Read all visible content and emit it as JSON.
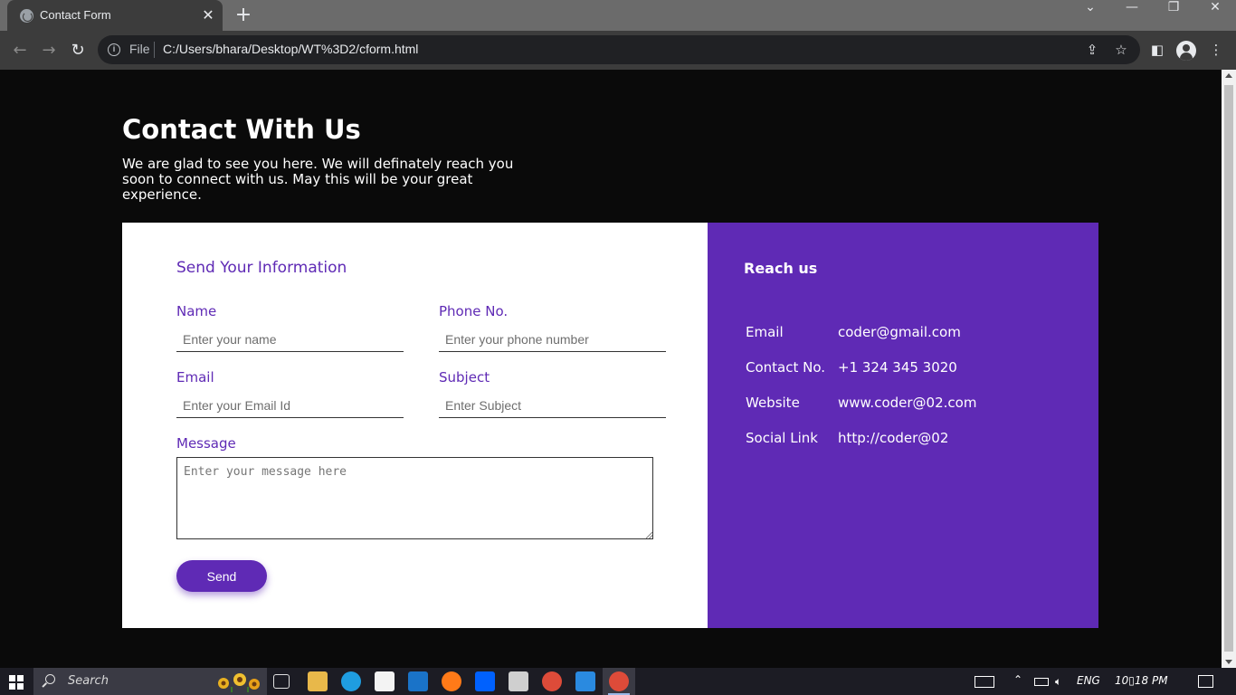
{
  "browser": {
    "tab_title": "Contact Form",
    "url_scheme": "File",
    "url": "C:/Users/bhara/Desktop/WT%3D2/cform.html"
  },
  "page": {
    "heading": "Contact With Us",
    "intro": "We are glad to see you here. We will definately reach you soon to connect with us. May this will be your great experience."
  },
  "form": {
    "title": "Send Your Information",
    "fields": [
      {
        "label": "Name",
        "placeholder": "Enter your name"
      },
      {
        "label": "Phone No.",
        "placeholder": "Enter your phone number"
      },
      {
        "label": "Email",
        "placeholder": "Enter your Email Id"
      },
      {
        "label": "Subject",
        "placeholder": "Enter Subject"
      }
    ],
    "message_label": "Message",
    "message_placeholder": "Enter your message here",
    "send_label": "Send"
  },
  "reach": {
    "title": "Reach us",
    "rows": [
      {
        "key": "Email",
        "value": "coder@gmail.com"
      },
      {
        "key": "Contact No.",
        "value": "+1 324 345 3020"
      },
      {
        "key": "Website",
        "value": "www.coder@02.com"
      },
      {
        "key": "Social Link",
        "value": "http://coder@02"
      }
    ]
  },
  "taskbar": {
    "search_text": "Search",
    "language": "ENG",
    "time": "10▯18 PM"
  },
  "colors": {
    "accent": "#5f2ab5",
    "page_background": "#0a0a0a",
    "chrome_tab": "#3c3c3c"
  }
}
